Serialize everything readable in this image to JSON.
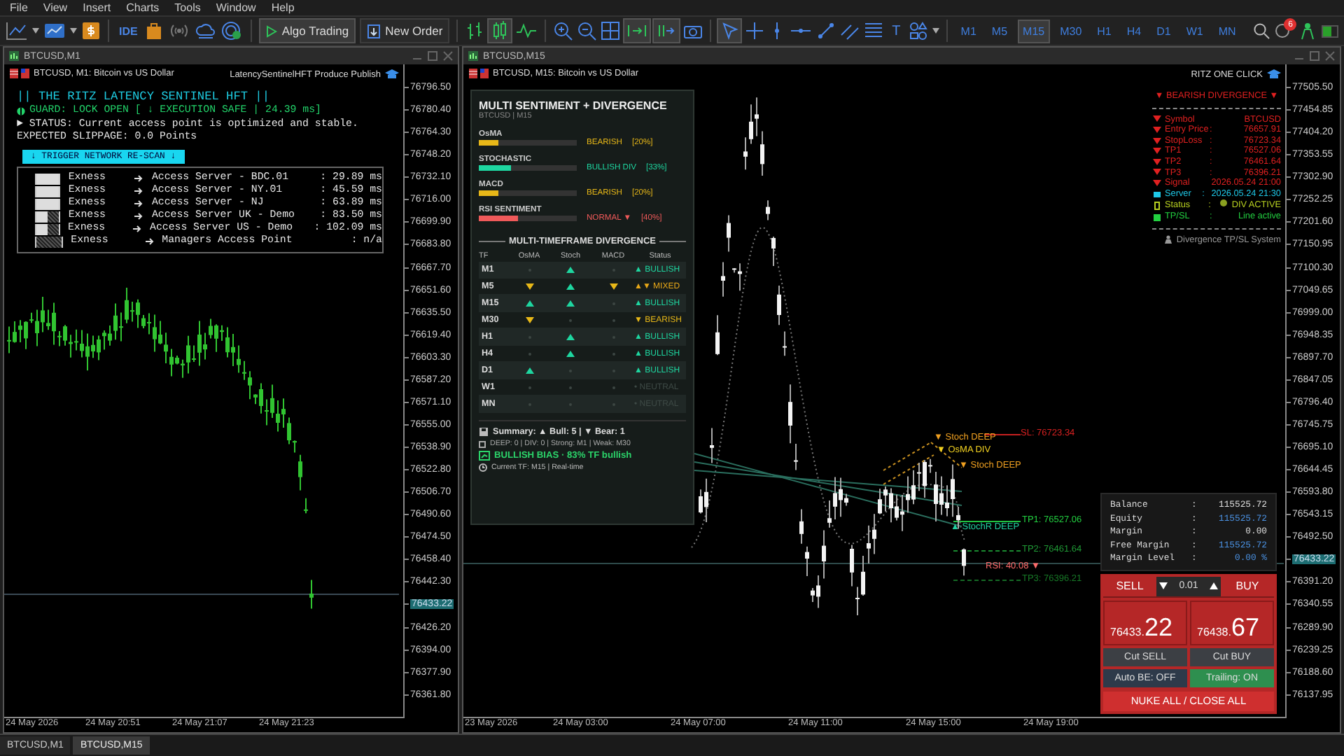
{
  "menu": [
    "File",
    "View",
    "Insert",
    "Charts",
    "Tools",
    "Window",
    "Help"
  ],
  "toolbar": {
    "ide": "IDE",
    "algo_trading": {
      "label": "Algo Trading",
      "on": true
    },
    "new_order": "New Order",
    "text_tool": "T",
    "notifications": "6",
    "timeframes": [
      {
        "label": "M1",
        "selected": false
      },
      {
        "label": "M5",
        "selected": false
      },
      {
        "label": "M15",
        "selected": true
      },
      {
        "label": "M30",
        "selected": false
      },
      {
        "label": "H1",
        "selected": false
      },
      {
        "label": "H4",
        "selected": false
      },
      {
        "label": "D1",
        "selected": false
      },
      {
        "label": "W1",
        "selected": false
      },
      {
        "label": "MN",
        "selected": false
      }
    ]
  },
  "chart_m1": {
    "title": "BTCUSD,M1",
    "header": "BTCUSD, M1: Bitcoin vs US Dollar",
    "indicator_name": "LatencySentinelHFT Produce Publish",
    "latency_panel": {
      "title": "|| THE RITZ LATENCY SENTINEL HFT ||",
      "guard": "GUARD: LOCK OPEN [ ↓ EXECUTION SAFE | 24.39 ms]",
      "status": "► STATUS: Current access point is optimized and stable.",
      "slippage": "EXPECTED SLIPPAGE: 0.0 Points",
      "rescan_button": "↓ TRIGGER NETWORK RE-SCAN ↓",
      "servers": [
        {
          "broker": "Exness",
          "server": "Access Server - BDC.01",
          "ping": ": 29.89 ms",
          "kind": "full"
        },
        {
          "broker": "Exness",
          "server": "Access Server - NY.01",
          "ping": ": 45.59 ms",
          "kind": "full"
        },
        {
          "broker": "Exness",
          "server": "Access Server - NJ",
          "ping": ": 63.89 ms",
          "kind": "full"
        },
        {
          "broker": "Exness",
          "server": "Access Server UK - Demo",
          "ping": ": 83.50 ms",
          "kind": "half"
        },
        {
          "broker": "Exness",
          "server": "Access Server US - Demo",
          "ping": ": 102.09 ms",
          "kind": "half"
        },
        {
          "broker": "Exness",
          "server": "Managers Access Point",
          "ping": ": n/a",
          "kind": "empty"
        }
      ]
    },
    "price_axis": [
      {
        "text": "76796.50",
        "highlighted": false
      },
      {
        "text": "76780.40",
        "highlighted": false
      },
      {
        "text": "76764.30",
        "highlighted": false
      },
      {
        "text": "76748.20",
        "highlighted": false
      },
      {
        "text": "76732.10",
        "highlighted": false
      },
      {
        "text": "76716.00",
        "highlighted": false
      },
      {
        "text": "76699.90",
        "highlighted": false
      },
      {
        "text": "76683.80",
        "highlighted": false
      },
      {
        "text": "76667.70",
        "highlighted": false
      },
      {
        "text": "76651.60",
        "highlighted": false
      },
      {
        "text": "76635.50",
        "highlighted": false
      },
      {
        "text": "76619.40",
        "highlighted": false
      },
      {
        "text": "76603.30",
        "highlighted": false
      },
      {
        "text": "76587.20",
        "highlighted": false
      },
      {
        "text": "76571.10",
        "highlighted": false
      },
      {
        "text": "76555.00",
        "highlighted": false
      },
      {
        "text": "76538.90",
        "highlighted": false
      },
      {
        "text": "76522.80",
        "highlighted": false
      },
      {
        "text": "76506.70",
        "highlighted": false
      },
      {
        "text": "76490.60",
        "highlighted": false
      },
      {
        "text": "76474.50",
        "highlighted": false
      },
      {
        "text": "76458.40",
        "highlighted": false
      },
      {
        "text": "76442.30",
        "highlighted": false
      },
      {
        "text": "76433.22",
        "highlighted": true
      },
      {
        "text": "76426.20",
        "highlighted": false
      },
      {
        "text": "76394.00",
        "highlighted": false
      },
      {
        "text": "76377.90",
        "highlighted": false
      },
      {
        "text": "76361.80",
        "highlighted": false
      }
    ],
    "time_axis": [
      "24 May 2026",
      "24 May 20:51",
      "24 May 21:07",
      "24 May 21:23"
    ]
  },
  "chart_m15": {
    "title": "BTCUSD,M15",
    "header": "BTCUSD, M15: Bitcoin vs US Dollar",
    "indicator_name": "RITZ ONE CLICK",
    "sentiment_panel": {
      "title": "MULTI SENTIMENT + DIVERGENCE",
      "subtitle": "BTCUSD  |  M15",
      "indicators": [
        {
          "name": "OsMA",
          "level": 0.2,
          "color": "#e8b818",
          "reading": "BEARISH",
          "percent": "[20%]"
        },
        {
          "name": "STOCHASTIC",
          "level": 0.33,
          "color": "#1ed6a0",
          "reading": "BULLISH DIV",
          "percent": "[33%]"
        },
        {
          "name": "MACD",
          "level": 0.2,
          "color": "#e8b818",
          "reading": "BEARISH",
          "percent": "[20%]"
        },
        {
          "name": "RSI SENTIMENT",
          "level": 0.4,
          "color": "#f05a5a",
          "reading": "NORMAL ▼",
          "percent": "[40%]"
        }
      ],
      "mtf_title": "MULTI-TIMEFRAME DIVERGENCE",
      "columns": [
        "TF",
        "OsMA",
        "Stoch",
        "MACD",
        "Status"
      ],
      "rows": [
        {
          "tf": "M1",
          "signals": [
            {
              "kind": "none"
            },
            {
              "kind": "up"
            },
            {
              "kind": "none"
            }
          ],
          "status": "▲ BULLISH",
          "kind": "bullish"
        },
        {
          "tf": "M5",
          "signals": [
            {
              "kind": "down"
            },
            {
              "kind": "up"
            },
            {
              "kind": "down"
            }
          ],
          "status": "▲▼ MIXED",
          "kind": "mixed"
        },
        {
          "tf": "M15",
          "signals": [
            {
              "kind": "up"
            },
            {
              "kind": "up"
            },
            {
              "kind": "none"
            }
          ],
          "status": "▲ BULLISH",
          "kind": "bullish"
        },
        {
          "tf": "M30",
          "signals": [
            {
              "kind": "down"
            },
            {
              "kind": "none"
            },
            {
              "kind": "none"
            }
          ],
          "status": "▼ BEARISH",
          "kind": "bearish"
        },
        {
          "tf": "H1",
          "signals": [
            {
              "kind": "none"
            },
            {
              "kind": "up"
            },
            {
              "kind": "none"
            }
          ],
          "status": "▲ BULLISH",
          "kind": "bullish"
        },
        {
          "tf": "H4",
          "signals": [
            {
              "kind": "none"
            },
            {
              "kind": "up"
            },
            {
              "kind": "none"
            }
          ],
          "status": "▲ BULLISH",
          "kind": "bullish"
        },
        {
          "tf": "D1",
          "signals": [
            {
              "kind": "up"
            },
            {
              "kind": "none"
            },
            {
              "kind": "none"
            }
          ],
          "status": "▲ BULLISH",
          "kind": "bullish"
        },
        {
          "tf": "W1",
          "signals": [
            {
              "kind": "none"
            },
            {
              "kind": "none"
            },
            {
              "kind": "none"
            }
          ],
          "status": "• NEUTRAL",
          "kind": "neutral"
        },
        {
          "tf": "MN",
          "signals": [
            {
              "kind": "none"
            },
            {
              "kind": "none"
            },
            {
              "kind": "none"
            }
          ],
          "status": "• NEUTRAL",
          "kind": "neutral"
        }
      ],
      "summary": "Summary: ▲ Bull: 5  |  ▼ Bear: 1",
      "details": "DEEP: 0 | DIV: 0 |  Strong: M1 |  Weak: M30",
      "bias": "BULLISH BIAS · 83% TF bullish",
      "current": "Current TF: M15 | Real-time"
    },
    "divergence_panel": {
      "title": "▼ BEARISH DIVERGENCE ▼",
      "footer": "Divergence TP/SL System",
      "rows": [
        {
          "label": "Symbol",
          "value": "BTCUSD",
          "kind": "signal"
        },
        {
          "label": "Entry Price",
          "separator": ":",
          "value": "76657.91",
          "kind": "signal"
        },
        {
          "label": "StopLoss",
          "separator": ":",
          "value": "76723.34",
          "kind": "signal"
        },
        {
          "label": "TP1",
          "separator": ":",
          "value": "76527.06",
          "kind": "signal"
        },
        {
          "label": "TP2",
          "separator": ":",
          "value": "76461.64",
          "kind": "signal"
        },
        {
          "label": "TP3",
          "separator": ":",
          "value": "76396.21",
          "kind": "signal"
        },
        {
          "label": "Signal",
          "value": "2026.05.24 21:00",
          "kind": "signal"
        },
        {
          "label": "Server",
          "separator": ":",
          "value": "2026.05.24 21:30",
          "kind": "server"
        },
        {
          "label": "Status",
          "separator": ":",
          "value": "DIV ACTIVE",
          "kind": "status"
        },
        {
          "label": "TP/SL",
          "separator": ":",
          "value": "Line active",
          "kind": "tpsl"
        }
      ]
    },
    "chart_labels": [
      {
        "text": "▼ Stoch DEEP",
        "kind": "stoch"
      },
      {
        "text": "SL: 76723.34",
        "kind": "sl"
      },
      {
        "text": "▼ OsMA DIV",
        "kind": "osma"
      },
      {
        "text": "▼ Stoch DEEP",
        "kind": "stoch"
      },
      {
        "text": "TP1: 76527.06",
        "kind": "tp1"
      },
      {
        "text": "▲ StochR DEEP",
        "kind": "stochr"
      },
      {
        "text": "TP2: 76461.64",
        "kind": "tp2"
      },
      {
        "text": "RSI: 40.08 ▼",
        "kind": "rsi"
      },
      {
        "text": "TP3: 76396.21",
        "kind": "tp3"
      }
    ],
    "trade_panel": {
      "separator": ":",
      "account": [
        {
          "label": "Balance",
          "value": "115525.72",
          "kind": "plain"
        },
        {
          "label": "Equity",
          "value": "115525.72",
          "kind": "accent"
        },
        {
          "label": "Margin",
          "value": "0.00",
          "kind": "plain"
        },
        {
          "label": "Free Margin",
          "value": "115525.72",
          "kind": "accent"
        },
        {
          "label": "Margin Level",
          "value": "0.00 %",
          "kind": "accent"
        }
      ],
      "sell": "SELL",
      "buy": "BUY",
      "lot": "0.01",
      "sell_price": {
        "main": "76433.",
        "big": "22"
      },
      "buy_price": {
        "main": "76438.",
        "big": "67"
      },
      "cut_sell": "Cut SELL",
      "cut_buy": "Cut BUY",
      "auto_be": {
        "label": "Auto BE: OFF",
        "on": false
      },
      "trailing": {
        "label": "Trailing: ON",
        "on": true
      },
      "nuke": "NUKE ALL / CLOSE ALL"
    },
    "price_axis": [
      {
        "text": "77505.50",
        "highlighted": false
      },
      {
        "text": "77454.85",
        "highlighted": false
      },
      {
        "text": "77404.20",
        "highlighted": false
      },
      {
        "text": "77353.55",
        "highlighted": false
      },
      {
        "text": "77302.90",
        "highlighted": false
      },
      {
        "text": "77252.25",
        "highlighted": false
      },
      {
        "text": "77201.60",
        "highlighted": false
      },
      {
        "text": "77150.95",
        "highlighted": false
      },
      {
        "text": "77100.30",
        "highlighted": false
      },
      {
        "text": "77049.65",
        "highlighted": false
      },
      {
        "text": "76999.00",
        "highlighted": false
      },
      {
        "text": "76948.35",
        "highlighted": false
      },
      {
        "text": "76897.70",
        "highlighted": false
      },
      {
        "text": "76847.05",
        "highlighted": false
      },
      {
        "text": "76796.40",
        "highlighted": false
      },
      {
        "text": "76745.75",
        "highlighted": false
      },
      {
        "text": "76695.10",
        "highlighted": false
      },
      {
        "text": "76644.45",
        "highlighted": false
      },
      {
        "text": "76593.80",
        "highlighted": false
      },
      {
        "text": "76543.15",
        "highlighted": false
      },
      {
        "text": "76492.50",
        "highlighted": false
      },
      {
        "text": "76433.22",
        "highlighted": true
      },
      {
        "text": "76391.20",
        "highlighted": false
      },
      {
        "text": "76340.55",
        "highlighted": false
      },
      {
        "text": "76289.90",
        "highlighted": false
      },
      {
        "text": "76239.25",
        "highlighted": false
      },
      {
        "text": "76188.60",
        "highlighted": false
      },
      {
        "text": "76137.95",
        "highlighted": false
      }
    ],
    "time_axis": [
      "23 May 2026",
      "24 May 03:00",
      "24 May 07:00",
      "24 May 11:00",
      "24 May 15:00",
      "24 May 19:00"
    ]
  },
  "bottom_tabs": [
    {
      "label": "BTCUSD,M1",
      "selected": false
    },
    {
      "label": "BTCUSD,M15",
      "selected": true
    }
  ]
}
